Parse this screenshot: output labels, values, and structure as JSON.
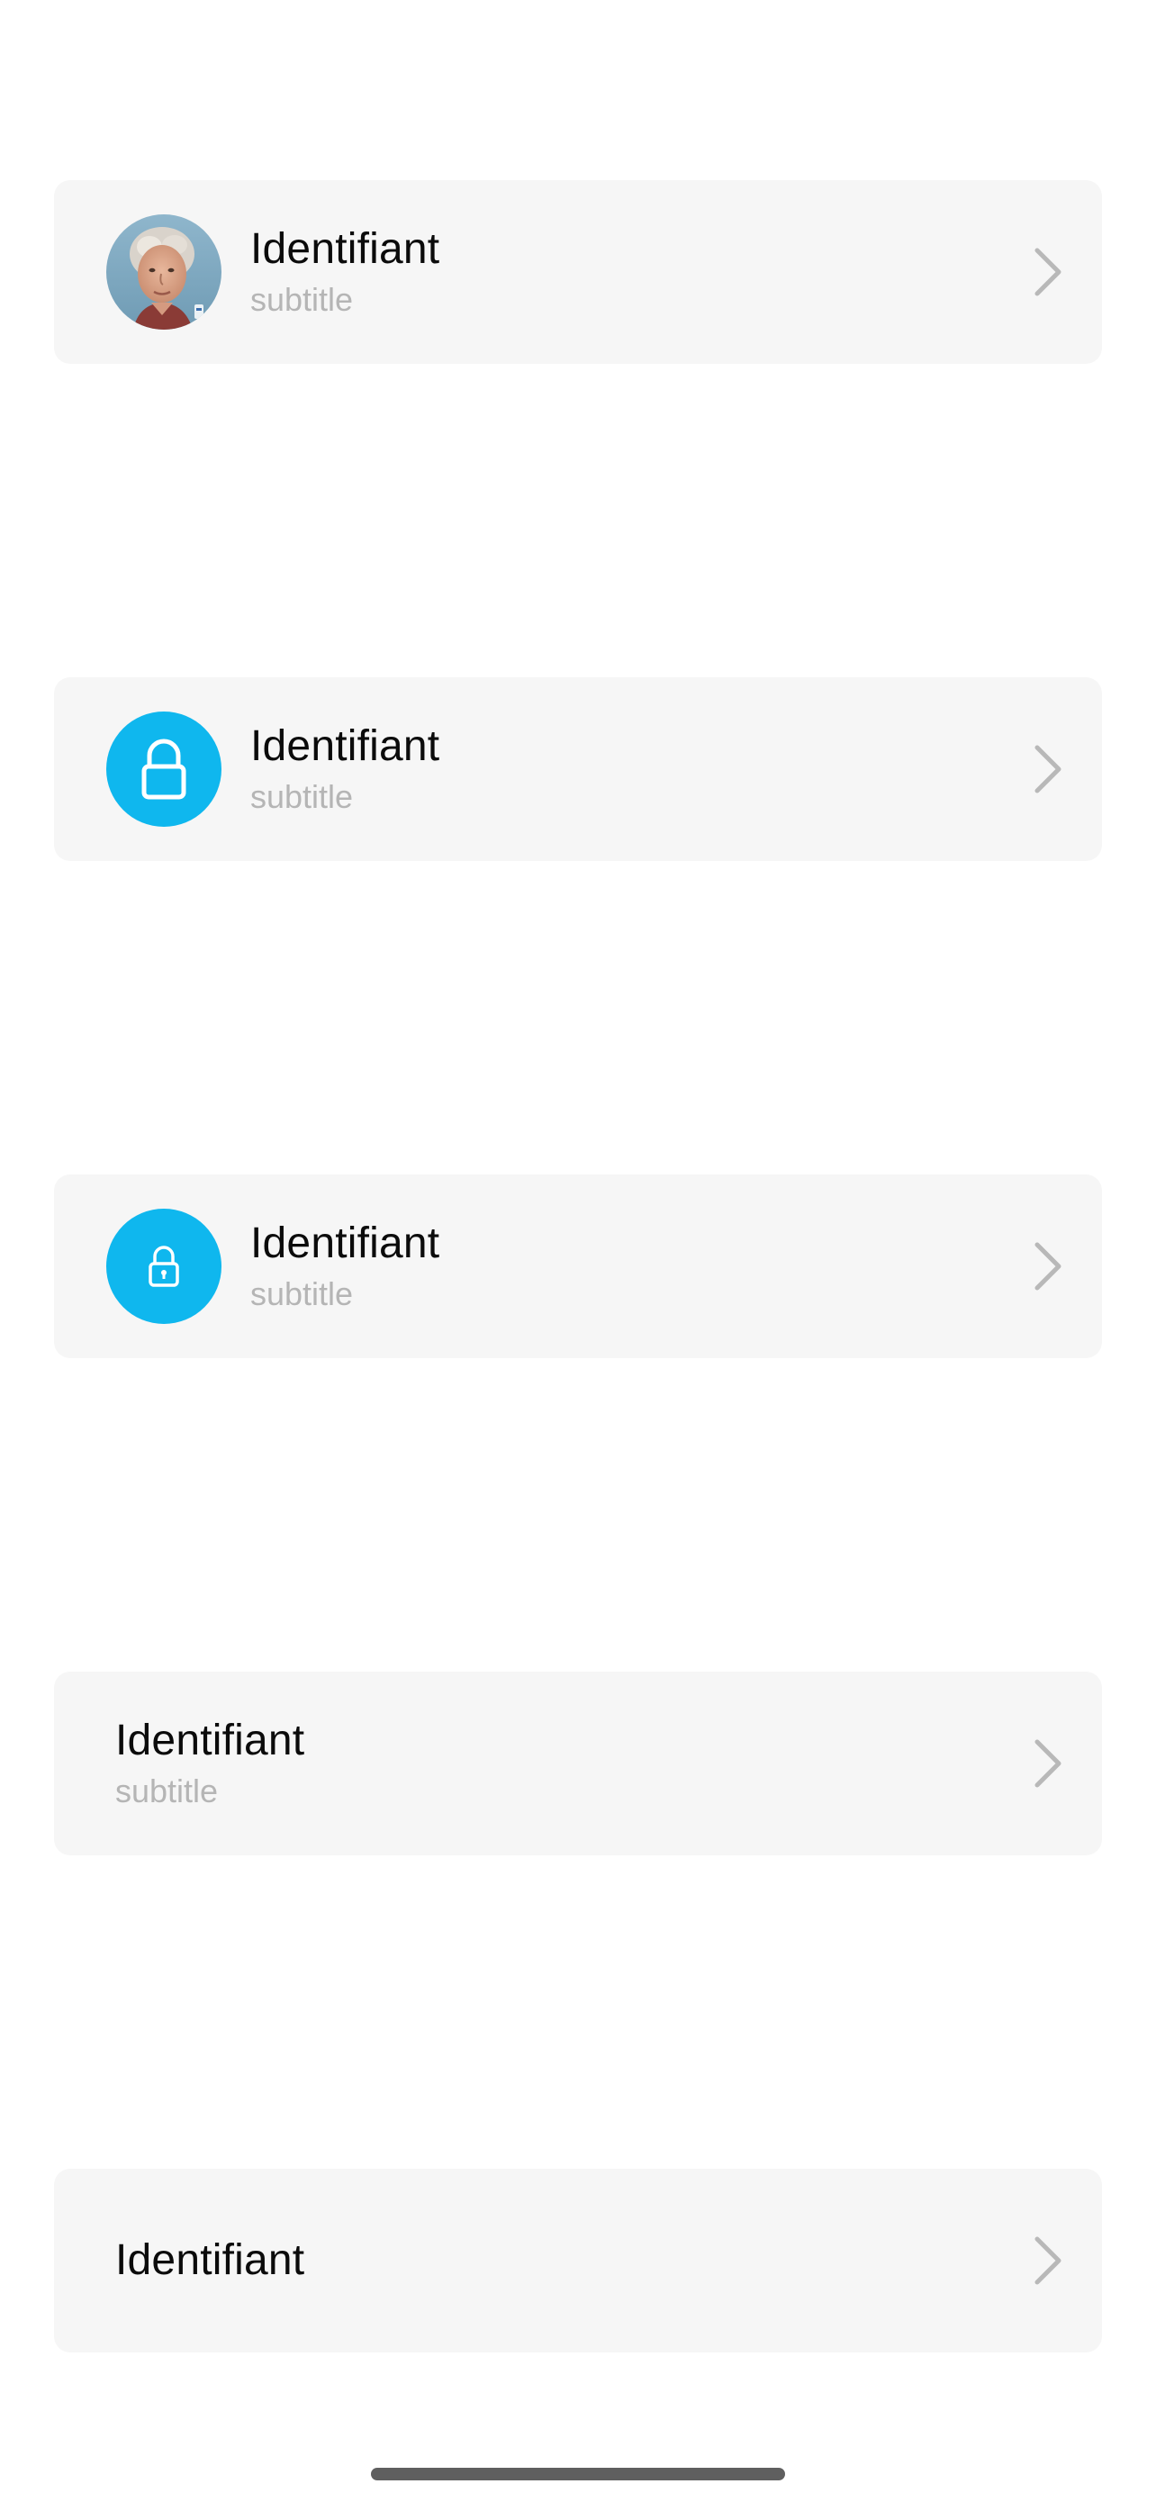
{
  "colors": {
    "page_bg": "#ffffff",
    "cell_bg": "#f6f6f6",
    "accent": "#0fb7ee",
    "title": "#0b0b0b",
    "subtitle": "#b5b5b5",
    "chevron": "#b8b8b8",
    "home_indicator": "#5f5f5f"
  },
  "rows": [
    {
      "leading": "avatar-photo",
      "title": "Identifiant",
      "subtitle": "subtitle",
      "trailing": "chevron-right-icon"
    },
    {
      "leading": "lock-icon",
      "title": "Identifiant",
      "subtitle": "subtitle",
      "trailing": "chevron-right-icon"
    },
    {
      "leading": "lock-keyhole-icon",
      "title": "Identifiant",
      "subtitle": "subtitle",
      "trailing": "chevron-right-icon"
    },
    {
      "leading": "",
      "title": "Identifiant",
      "subtitle": "subtitle",
      "trailing": "chevron-right-icon"
    },
    {
      "leading": "",
      "title": "Identifiant",
      "trailing": "chevron-right-icon"
    }
  ]
}
